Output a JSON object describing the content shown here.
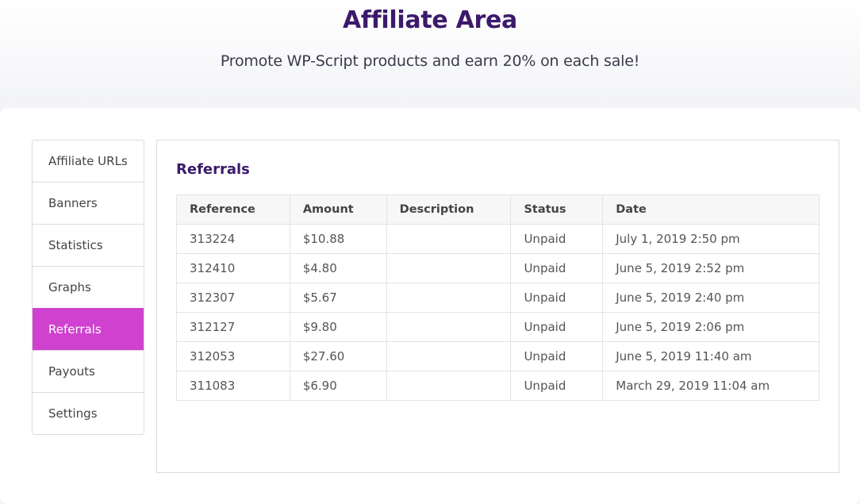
{
  "hero": {
    "title": "Affiliate Area",
    "subtitle": "Promote WP-Script products and earn 20% on each sale!"
  },
  "sidebar": {
    "items": [
      {
        "label": "Affiliate URLs",
        "active": false
      },
      {
        "label": "Banners",
        "active": false
      },
      {
        "label": "Statistics",
        "active": false
      },
      {
        "label": "Graphs",
        "active": false
      },
      {
        "label": "Referrals",
        "active": true
      },
      {
        "label": "Payouts",
        "active": false
      },
      {
        "label": "Settings",
        "active": false
      }
    ]
  },
  "panel": {
    "title": "Referrals",
    "table": {
      "headers": [
        "Reference",
        "Amount",
        "Description",
        "Status",
        "Date"
      ],
      "rows": [
        [
          "313224",
          "$10.88",
          "",
          "Unpaid",
          "July 1, 2019 2:50 pm"
        ],
        [
          "312410",
          "$4.80",
          "",
          "Unpaid",
          "June 5, 2019 2:52 pm"
        ],
        [
          "312307",
          "$5.67",
          "",
          "Unpaid",
          "June 5, 2019 2:40 pm"
        ],
        [
          "312127",
          "$9.80",
          "",
          "Unpaid",
          "June 5, 2019 2:06 pm"
        ],
        [
          "312053",
          "$27.60",
          "",
          "Unpaid",
          "June 5, 2019 11:40 am"
        ],
        [
          "311083",
          "$6.90",
          "",
          "Unpaid",
          "March 29, 2019 11:04 am"
        ]
      ]
    }
  },
  "colors": {
    "accent": "#cf42cf",
    "title": "#3c1a6b"
  }
}
